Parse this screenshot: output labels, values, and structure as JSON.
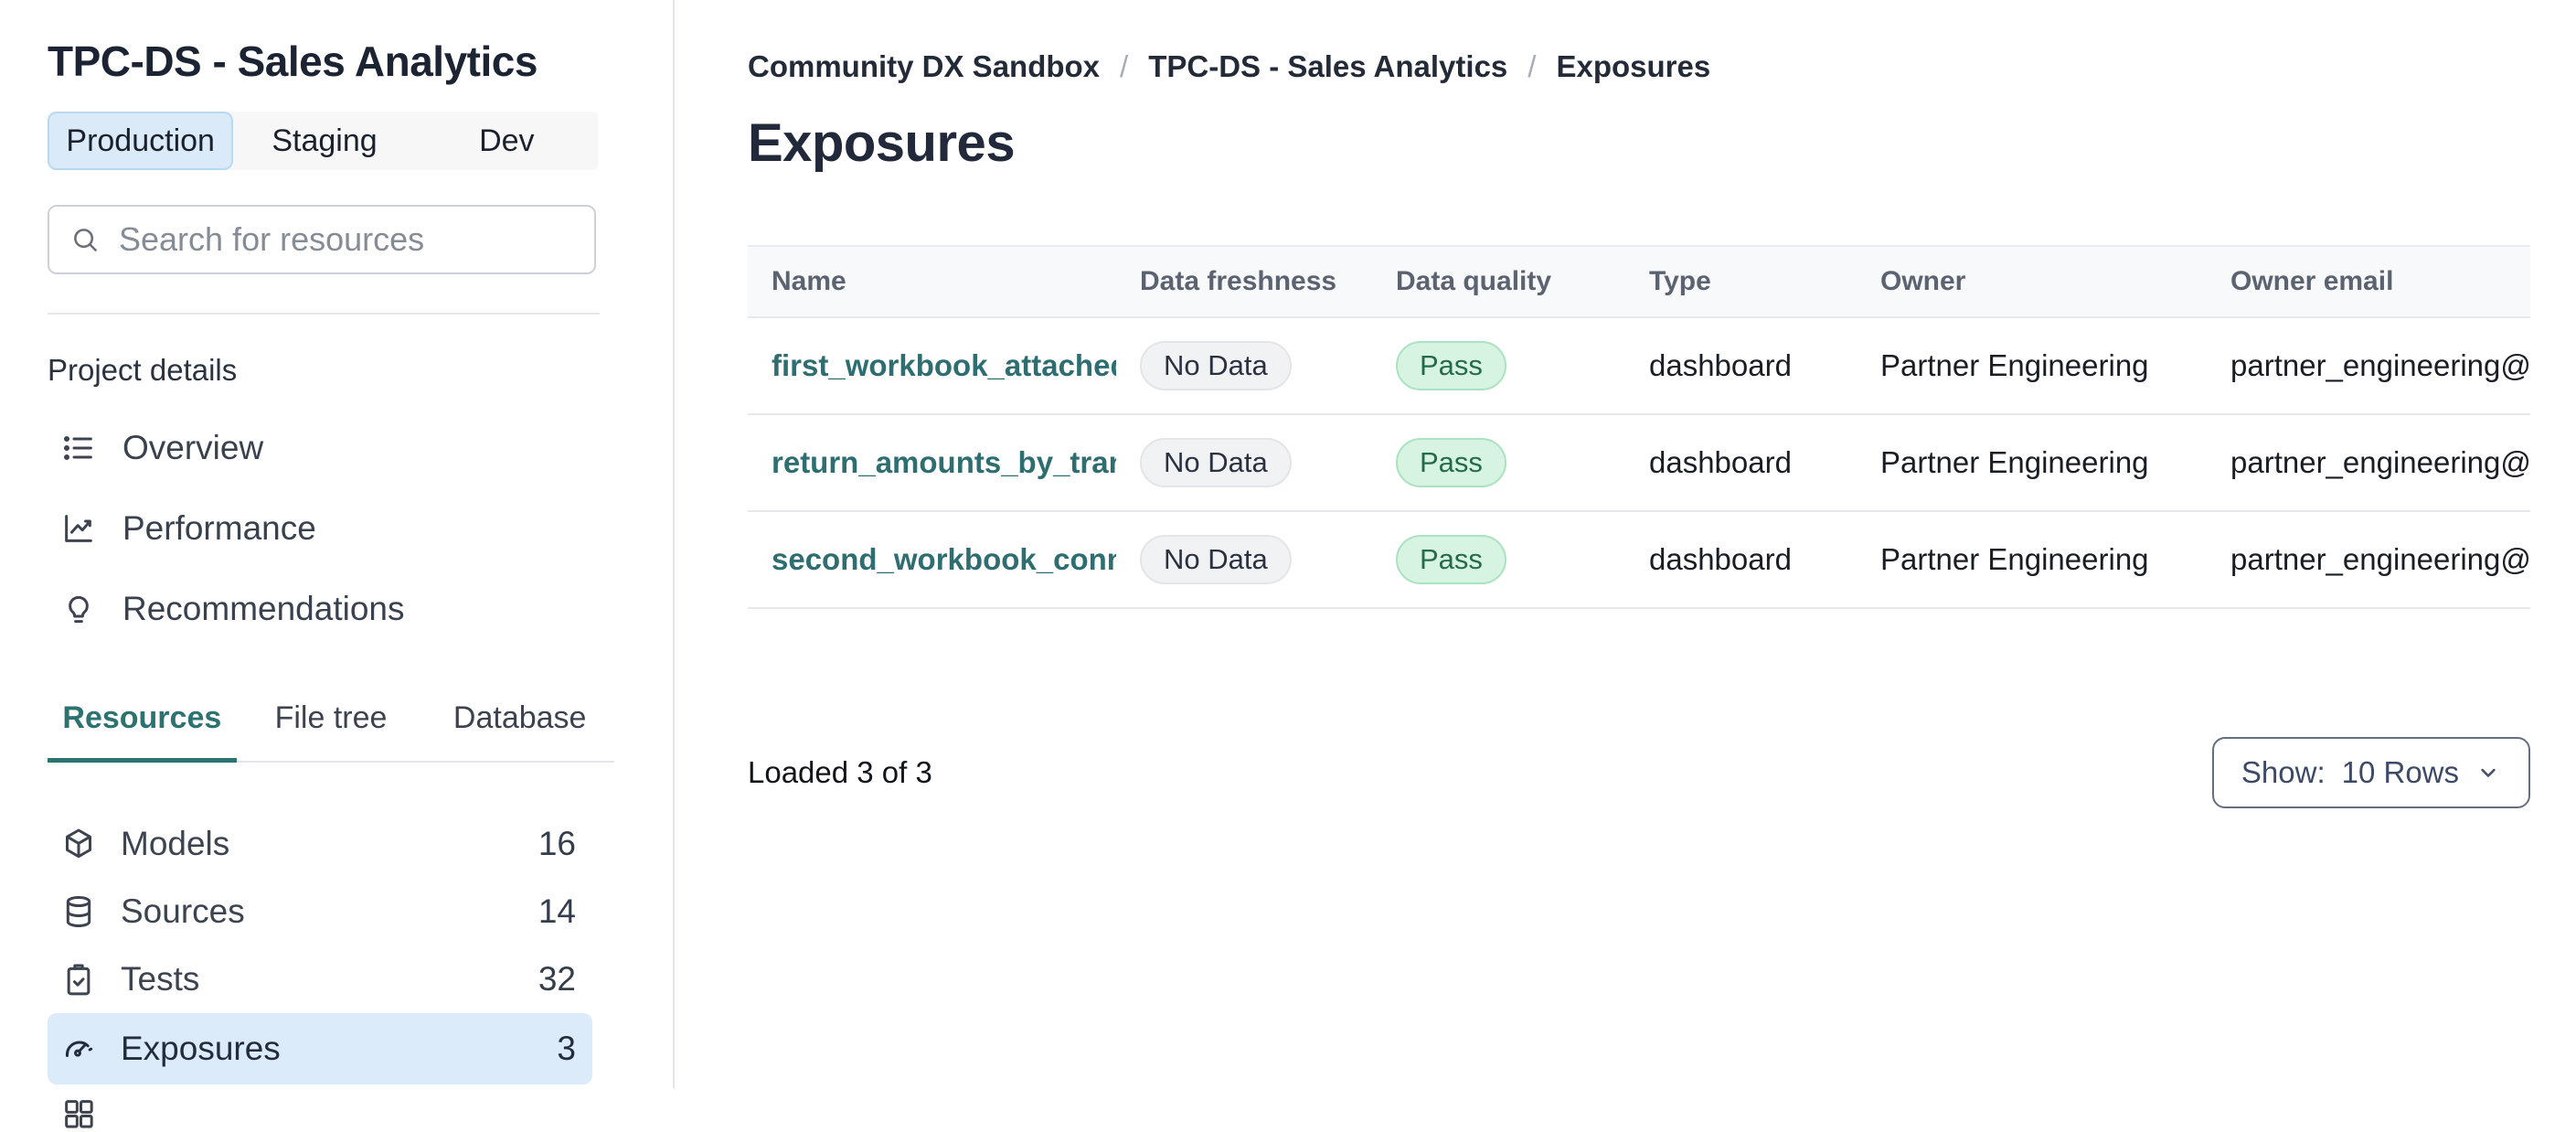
{
  "sidebar": {
    "title": "TPC-DS - Sales Analytics",
    "env_tabs": [
      {
        "label": "Production",
        "selected": true
      },
      {
        "label": "Staging",
        "selected": false
      },
      {
        "label": "Dev",
        "selected": false
      }
    ],
    "search": {
      "placeholder": "Search for resources"
    },
    "section_label": "Project details",
    "nav": [
      {
        "icon": "list-icon",
        "label": "Overview"
      },
      {
        "icon": "line-chart-icon",
        "label": "Performance"
      },
      {
        "icon": "lightbulb-icon",
        "label": "Recommendations"
      }
    ],
    "resource_tabs": [
      {
        "label": "Resources",
        "selected": true
      },
      {
        "label": "File tree",
        "selected": false
      },
      {
        "label": "Database",
        "selected": false
      }
    ],
    "resources": [
      {
        "icon": "cube-icon",
        "label": "Models",
        "count": "16",
        "selected": false
      },
      {
        "icon": "database-icon",
        "label": "Sources",
        "count": "14",
        "selected": false
      },
      {
        "icon": "clipboard-check-icon",
        "label": "Tests",
        "count": "32",
        "selected": false
      },
      {
        "icon": "gauge-icon",
        "label": "Exposures",
        "count": "3",
        "selected": true
      }
    ]
  },
  "main": {
    "breadcrumb": [
      "Community DX Sandbox",
      "TPC-DS - Sales Analytics",
      "Exposures"
    ],
    "title": "Exposures",
    "table": {
      "columns": [
        "Name",
        "Data freshness",
        "Data quality",
        "Type",
        "Owner",
        "Owner email"
      ],
      "rows": [
        {
          "name": "first_workbook_attached…",
          "freshness": "No Data",
          "quality": "Pass",
          "type": "dashboard",
          "owner": "Partner Engineering",
          "email": "partner_engineering@dbt…"
        },
        {
          "name": "return_amounts_by_tran…",
          "freshness": "No Data",
          "quality": "Pass",
          "type": "dashboard",
          "owner": "Partner Engineering",
          "email": "partner_engineering@dbt…"
        },
        {
          "name": "second_workbook_conn…",
          "freshness": "No Data",
          "quality": "Pass",
          "type": "dashboard",
          "owner": "Partner Engineering",
          "email": "partner_engineering@dbt…"
        }
      ]
    },
    "footer": {
      "loaded": "Loaded 3 of 3",
      "show_label": "Show:",
      "show_value": "10 Rows"
    }
  },
  "colors": {
    "accent_teal": "#2c7370",
    "link_teal": "#2e6e71",
    "selected_blue_bg": "#dcebfa",
    "env_selected_bg": "#daeaf9",
    "env_selected_border": "#b9d9f2",
    "pass_bg": "#d7f3e1",
    "pass_border": "#abe3c0",
    "pass_text": "#256b4a",
    "nodata_bg": "#f1f2f4",
    "header_bg": "#f8f9fa",
    "divider": "#e7e8ea"
  }
}
